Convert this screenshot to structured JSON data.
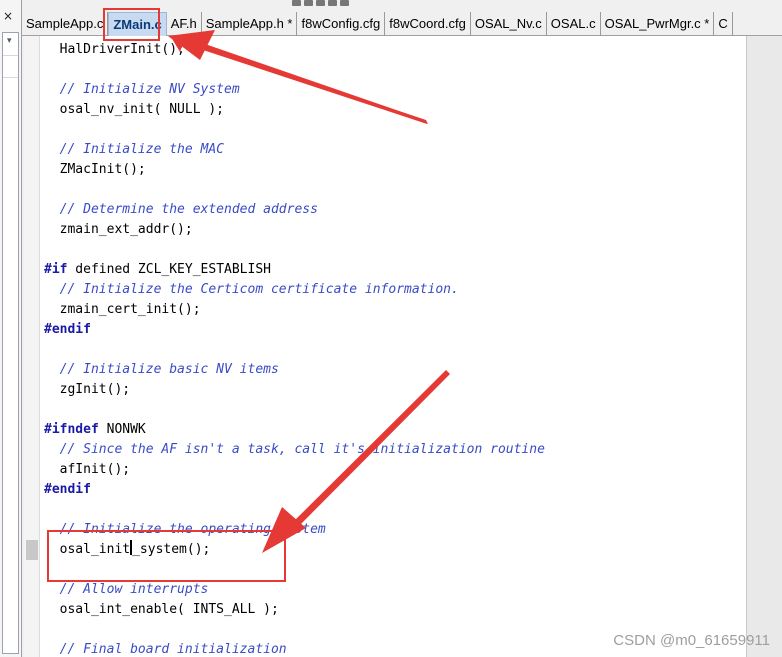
{
  "tabs": [
    {
      "label": "SampleApp.c",
      "active": false
    },
    {
      "label": "ZMain.c",
      "active": true
    },
    {
      "label": "AF.h",
      "active": false
    },
    {
      "label": "SampleApp.h *",
      "active": false
    },
    {
      "label": "f8wConfig.cfg",
      "active": false
    },
    {
      "label": "f8wCoord.cfg",
      "active": false
    },
    {
      "label": "OSAL_Nv.c",
      "active": false
    },
    {
      "label": "OSAL.c",
      "active": false
    },
    {
      "label": "OSAL_PwrMgr.c *",
      "active": false
    },
    {
      "label": "C",
      "active": false
    }
  ],
  "left_panel": {
    "close_glyph": "×",
    "collapse_glyph": "▾"
  },
  "editor": {
    "lines": [
      {
        "text": "  HalDriverInit();",
        "type": "code"
      },
      {
        "text": "",
        "type": "code"
      },
      {
        "text": "  // Initialize NV System",
        "type": "comment"
      },
      {
        "text": "  osal_nv_init( NULL );",
        "type": "code"
      },
      {
        "text": "",
        "type": "code"
      },
      {
        "text": "  // Initialize the MAC",
        "type": "comment"
      },
      {
        "text": "  ZMacInit();",
        "type": "code"
      },
      {
        "text": "",
        "type": "code"
      },
      {
        "text": "  // Determine the extended address",
        "type": "comment"
      },
      {
        "text": "  zmain_ext_addr();",
        "type": "code"
      },
      {
        "text": "",
        "type": "code"
      },
      {
        "text": "#if defined ZCL_KEY_ESTABLISH",
        "type": "directive",
        "kw": "#if",
        "rest": " defined ZCL_KEY_ESTABLISH"
      },
      {
        "text": "  // Initialize the Certicom certificate information.",
        "type": "comment"
      },
      {
        "text": "  zmain_cert_init();",
        "type": "code"
      },
      {
        "text": "#endif",
        "type": "directive",
        "kw": "#endif",
        "rest": ""
      },
      {
        "text": "",
        "type": "code"
      },
      {
        "text": "  // Initialize basic NV items",
        "type": "comment"
      },
      {
        "text": "  zgInit();",
        "type": "code"
      },
      {
        "text": "",
        "type": "code"
      },
      {
        "text": "#ifndef NONWK",
        "type": "directive",
        "kw": "#ifndef",
        "rest": " NONWK"
      },
      {
        "text": "  // Since the AF isn't a task, call it's initialization routine",
        "type": "comment"
      },
      {
        "text": "  afInit();",
        "type": "code"
      },
      {
        "text": "#endif",
        "type": "directive",
        "kw": "#endif",
        "rest": ""
      },
      {
        "text": "",
        "type": "code"
      },
      {
        "text": "  // Initialize the operating system",
        "type": "comment"
      },
      {
        "text": "  osal_init_system();",
        "type": "code",
        "caret_after": "  osal_init",
        "caret_before": "_system();"
      },
      {
        "text": "",
        "type": "code"
      },
      {
        "text": "  // Allow interrupts",
        "type": "comment"
      },
      {
        "text": "  osal_int_enable( INTS_ALL );",
        "type": "code"
      },
      {
        "text": "",
        "type": "code"
      },
      {
        "text": "  // Final board initialization",
        "type": "comment"
      }
    ],
    "current_line_index": 25
  },
  "annotations": {
    "color": "#e53935"
  },
  "watermark": "CSDN @m0_61659911"
}
